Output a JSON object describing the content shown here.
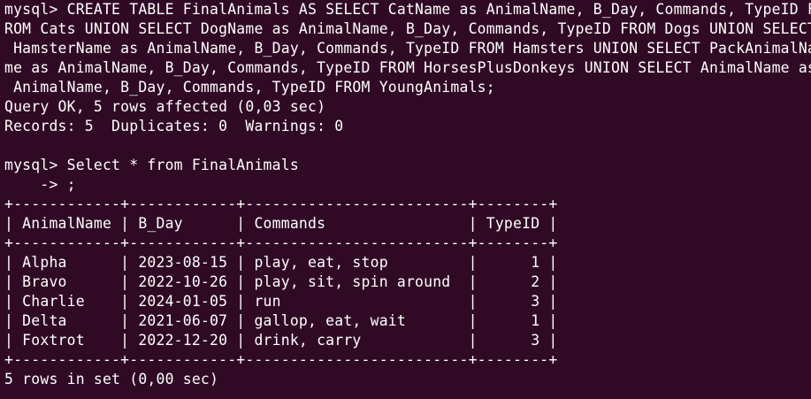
{
  "terminal": {
    "lines": [
      "mysql> CREATE TABLE FinalAnimals AS SELECT CatName as AnimalName, B_Day, Commands, TypeID F",
      "ROM Cats UNION SELECT DogName as AnimalName, B_Day, Commands, TypeID FROM Dogs UNION SELECT",
      " HamsterName as AnimalName, B_Day, Commands, TypeID FROM Hamsters UNION SELECT PackAnimalNa",
      "me as AnimalName, B_Day, Commands, TypeID FROM HorsesPlusDonkeys UNION SELECT AnimalName as",
      " AnimalName, B_Day, Commands, TypeID FROM YoungAnimals;",
      "Query OK, 5 rows affected (0,03 sec)",
      "Records: 5  Duplicates: 0  Warnings: 0",
      "",
      "mysql> Select * from FinalAnimals",
      "    -> ;",
      "+------------+------------+-------------------------+--------+",
      "| AnimalName | B_Day      | Commands                | TypeID |",
      "+------------+------------+-------------------------+--------+",
      "| Alpha      | 2023-08-15 | play, eat, stop         |      1 |",
      "| Bravo      | 2022-10-26 | play, sit, spin around  |      2 |",
      "| Charlie    | 2024-01-05 | run                     |      3 |",
      "| Delta      | 2021-06-07 | gallop, eat, wait       |      1 |",
      "| Foxtrot    | 2022-12-20 | drink, carry            |      3 |",
      "+------------+------------+-------------------------+--------+",
      "5 rows in set (0,00 sec)"
    ]
  }
}
